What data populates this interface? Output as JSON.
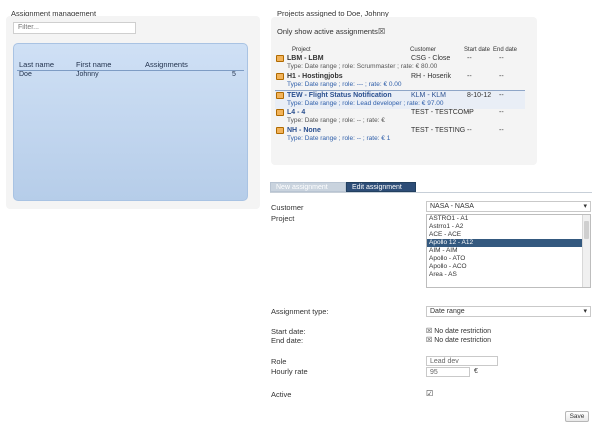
{
  "left": {
    "title": "Assignment management",
    "filter_placeholder": "Filter...",
    "table": {
      "headers": [
        "Last name",
        "First name",
        "Assignments"
      ],
      "rows": [
        {
          "last": "Doe",
          "first": "Johnny",
          "count": "5"
        }
      ]
    }
  },
  "right": {
    "title": "Projects assigned to Doe, Johnny",
    "only_active_label": "Only show active assignments",
    "headers": {
      "project": "Project",
      "customer": "Customer",
      "start": "Start date",
      "end": "End date"
    },
    "projects": [
      {
        "project": "LBM - LBM",
        "customer": "CSG - Close",
        "start": "--",
        "end": "--",
        "sub": "Type: Date range ; role: Scrummaster ; rate: € 80.00",
        "sub_blue": false
      },
      {
        "project": "H1 - Hostingjobs",
        "customer": "RH - Hoserik",
        "start": "--",
        "end": "--",
        "sub": "Type: Date range ; role: --- ; rate: € 0.00",
        "sub_blue": true
      },
      {
        "project": "TEW - Flight Status Notification",
        "customer": "KLM - KLM",
        "start": "8-10-12",
        "end": "--",
        "sub": "Type: Date range ; role: Lead developer ; rate: € 97.00",
        "sub_blue": true
      },
      {
        "project": "L4 - 4",
        "customer": "TEST - TESTCOMP",
        "start": "--",
        "end": "--",
        "sub": "Type: Date range ; role: -- ; rate: €",
        "sub_blue": false
      },
      {
        "project": "NH - None",
        "customer": "TEST - TESTING",
        "start": "--",
        "end": "--",
        "sub": "Type: Date range ; role: -- ; rate: € 1",
        "sub_blue": true
      }
    ]
  },
  "tabs": {
    "new": "New assignment",
    "edit": "Edit assignment"
  },
  "form": {
    "customer_label": "Customer",
    "customer_value": "NASA - NASA",
    "project_label": "Project",
    "project_options": [
      "ASTRO1 - A1",
      "Astrro1 - A2",
      "ACE - ACE",
      "Apollo 12 - A12",
      "AIM - AIM",
      "Apollo - ATO",
      "Apollo - ACO",
      "Area - AS"
    ],
    "project_selected": "Apollo 12 - A12",
    "assignment_type_label": "Assignment type",
    "assignment_type_value": "Date range",
    "start_label": "Start date",
    "end_label": "End date",
    "no_date_restriction": "No date restriction",
    "role_label": "Role",
    "role_value": "Lead dev",
    "rate_label": "Hourly rate",
    "rate_value": "95",
    "rate_unit": "€",
    "active_label": "Active",
    "save_button": "Save"
  }
}
